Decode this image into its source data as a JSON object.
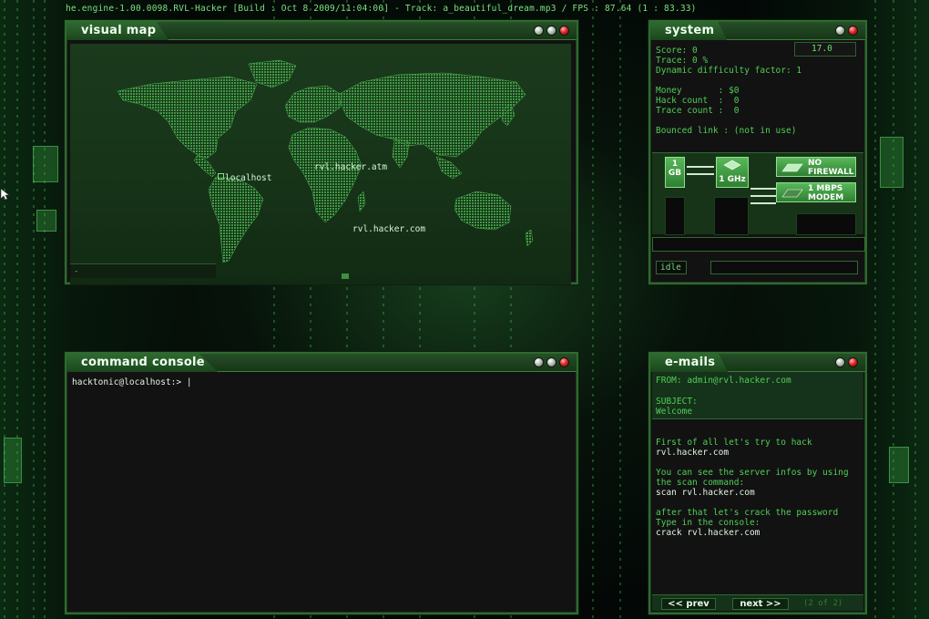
{
  "topbar": {
    "text": "he.engine-1.00.0098.RVL-Hacker [Build : Oct  8 2009/11:04:00] - Track: a_beautiful_dream.mp3 / FPS : 87.64 (1 : 83.33)"
  },
  "visual_map": {
    "title": "visual map",
    "labels": {
      "localhost": "localhost",
      "atm": "rvl.hacker.atm",
      "com": "rvl.hacker.com"
    },
    "status": "-"
  },
  "system": {
    "title": "system",
    "counter": "17.0",
    "score": "Score: 0",
    "trace": "Trace: 0 %",
    "difficulty": "Dynamic difficulty factor: 1",
    "money": "Money       : $0",
    "hack_count": "Hack count  :  0",
    "trace_count": "Trace count :  0",
    "bounced_link": "Bounced link : (not in use)",
    "hardware": {
      "ram": "1\nGB",
      "cpu": "1 GHz",
      "firewall": "NO\nFIREWALL",
      "modem": "1 MBPS\nMODEM"
    },
    "status": "idle"
  },
  "console": {
    "title": "command console",
    "prompt": "hacktonic@localhost:> ",
    "input_value": "|"
  },
  "emails": {
    "title": "e-mails",
    "from": "FROM: admin@rvl.hacker.com",
    "subject_label": "SUBJECT:",
    "subject": "Welcome",
    "body": [
      "First of all let's try to hack",
      "rvl.hacker.com",
      "",
      "You can see the server infos by using",
      "the scan command:",
      "scan rvl.hacker.com",
      "",
      "after that let's crack the password",
      "Type in the console:",
      "crack rvl.hacker.com"
    ],
    "prev_label": "<< prev",
    "next_label": "next >>",
    "page": "(2 of 2)"
  },
  "icons": [
    "minimize-icon",
    "maximize-icon",
    "close-icon",
    "cpu-chip-icon",
    "firewall-icon",
    "modem-icon",
    "mouse-pointer-icon"
  ],
  "colors": {
    "accent": "#4fcf55",
    "panel_border": "#2f6a30",
    "panel_bg": "#121212",
    "close_button": "#e02020"
  }
}
